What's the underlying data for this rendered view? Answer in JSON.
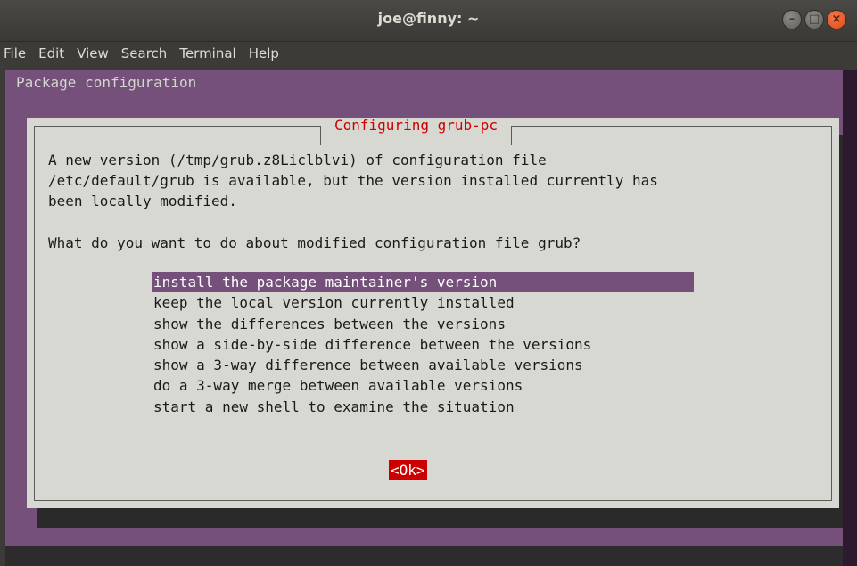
{
  "window": {
    "title": "joe@finny: ~"
  },
  "menubar": {
    "items": [
      "File",
      "Edit",
      "View",
      "Search",
      "Terminal",
      "Help"
    ]
  },
  "terminal": {
    "header": "Package configuration"
  },
  "dialog": {
    "title": "Configuring grub-pc",
    "description_lines": [
      "A new version (/tmp/grub.z8Liclblvi) of configuration file",
      "/etc/default/grub is available, but the version installed currently has",
      "been locally modified."
    ],
    "question": "What do you want to do about modified configuration file grub?",
    "options": [
      "install the package maintainer's version",
      "keep the local version currently installed",
      "show the differences between the versions",
      "show a side-by-side difference between the versions",
      "show a 3-way difference between available versions",
      "do a 3-way merge between available versions",
      "start a new shell to examine the situation"
    ],
    "selected_index": 0,
    "ok_label": "<Ok>"
  },
  "colors": {
    "terminal_bg": "#75507b",
    "dialog_bg": "#d8d8d2",
    "title_red": "#cc0000",
    "selection": "#75507b",
    "close_button": "#df4a16"
  }
}
